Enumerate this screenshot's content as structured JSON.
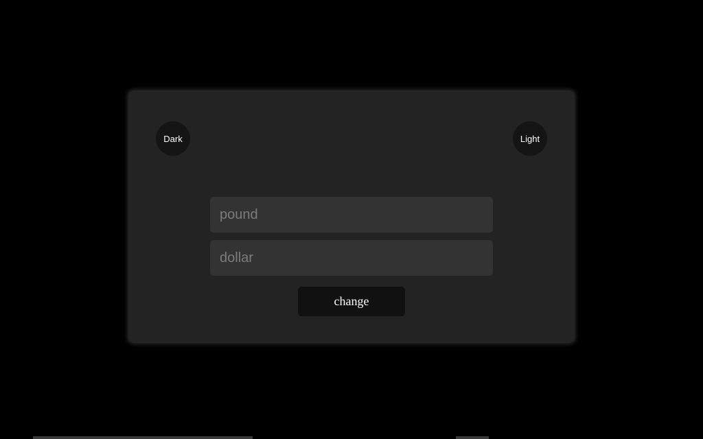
{
  "theme": {
    "dark_label": "Dark",
    "light_label": "Light"
  },
  "converter": {
    "pound_placeholder": "pound",
    "dollar_placeholder": "dollar",
    "button_label": "change"
  },
  "colors": {
    "background": "#000000",
    "card": "#232323",
    "input": "#333333",
    "button": "#111111"
  }
}
